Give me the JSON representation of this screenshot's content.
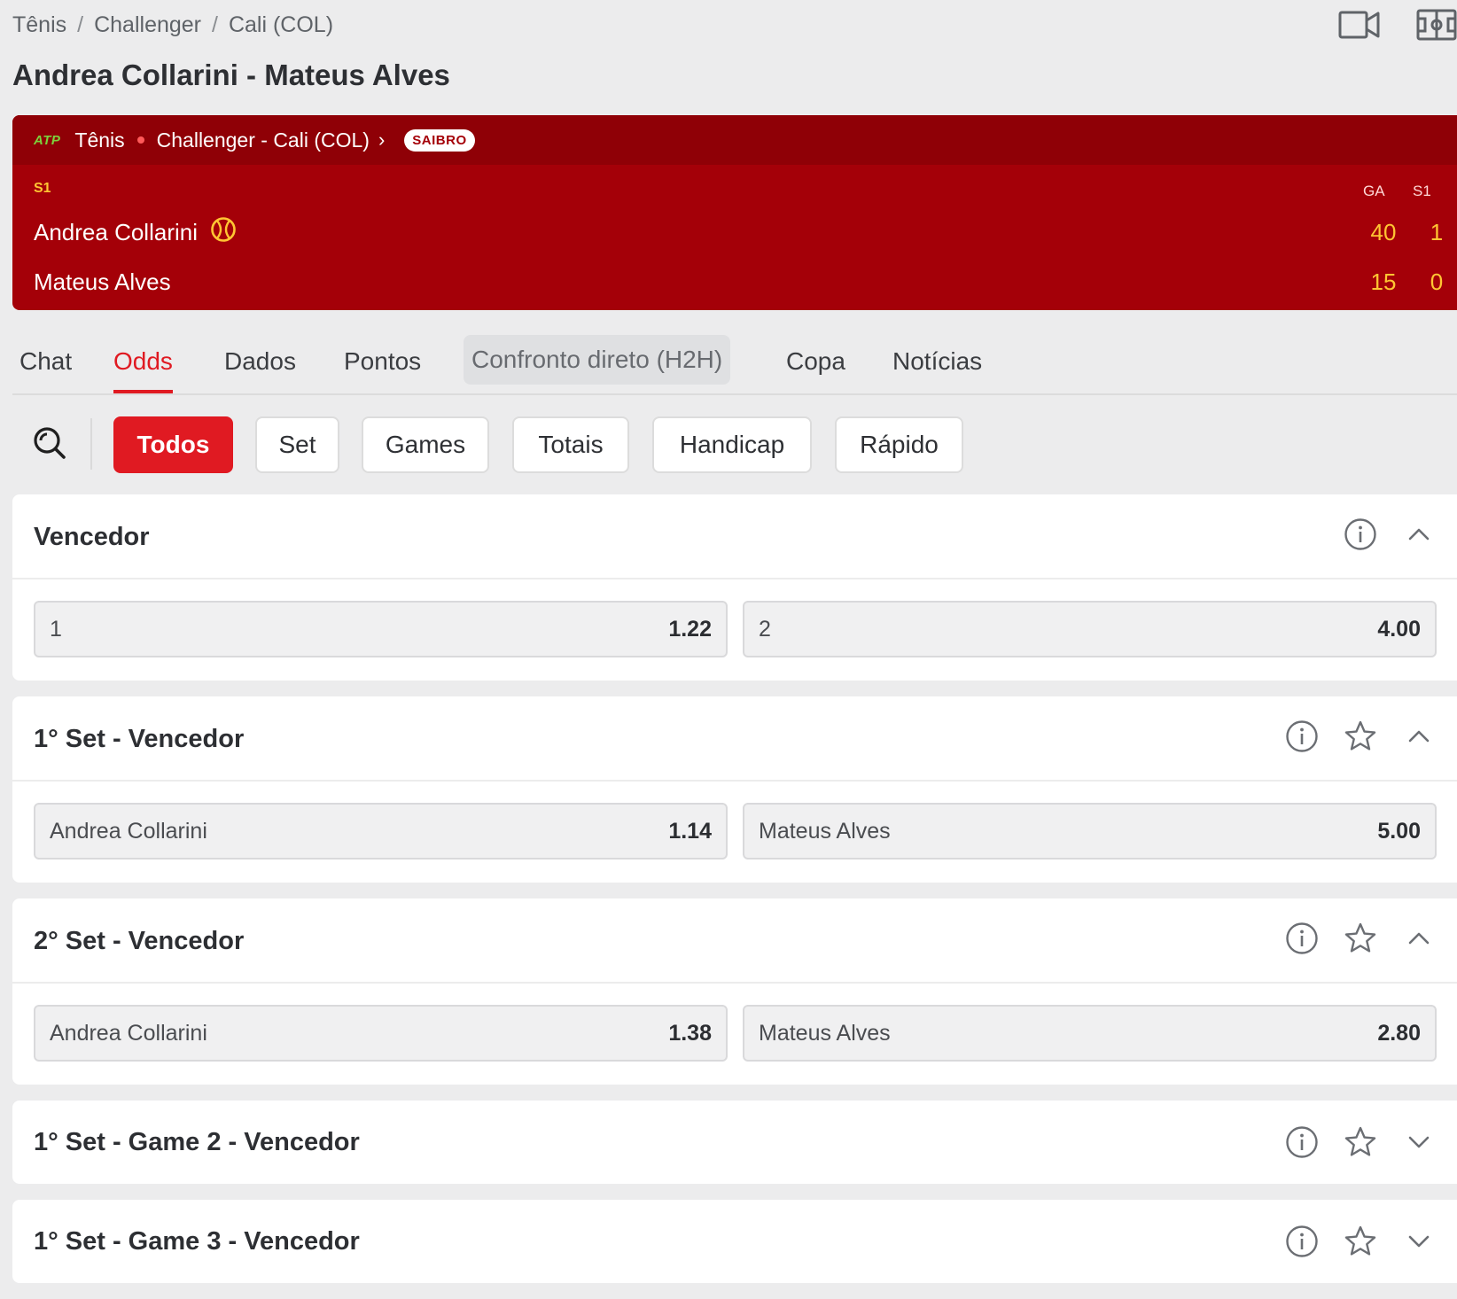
{
  "breadcrumb": {
    "items": [
      "Tênis",
      "Challenger",
      "Cali (COL)"
    ],
    "sep": "/"
  },
  "title": "Andrea Collarini - Mateus Alves",
  "scoreboard": {
    "tour": "ATP",
    "sport": "Tênis",
    "competition": "Challenger - Cali (COL)",
    "chevron": "›",
    "surface": "SAIBRO",
    "set_label": "S1",
    "col_game": "GA",
    "col_set": "S1",
    "players": [
      {
        "name": "Andrea Collarini",
        "serving": true,
        "game": "40",
        "set1": "1"
      },
      {
        "name": "Mateus Alves",
        "serving": false,
        "game": "15",
        "set1": "0"
      }
    ],
    "colors": {
      "header": "#8f0006",
      "body": "#a40008",
      "score": "#ffc533"
    }
  },
  "tabs": [
    {
      "label": "Chat",
      "active": false
    },
    {
      "label": "Odds",
      "active": true
    },
    {
      "label": "Dados",
      "active": false
    },
    {
      "label": "Pontos",
      "active": false
    },
    {
      "label": "Confronto direto (H2H)",
      "active": false,
      "highlighted": true
    },
    {
      "label": "Copa",
      "active": false
    },
    {
      "label": "Notícias",
      "active": false
    }
  ],
  "filters": [
    {
      "label": "Todos",
      "active": true
    },
    {
      "label": "Set",
      "active": false
    },
    {
      "label": "Games",
      "active": false
    },
    {
      "label": "Totais",
      "active": false
    },
    {
      "label": "Handicap",
      "active": false
    },
    {
      "label": "Rápido",
      "active": false
    }
  ],
  "markets": [
    {
      "title": "Vencedor",
      "favorite_icon": false,
      "expanded": true,
      "odds": [
        {
          "label": "1",
          "value": "1.22"
        },
        {
          "label": "2",
          "value": "4.00"
        }
      ]
    },
    {
      "title": "1° Set - Vencedor",
      "favorite_icon": true,
      "expanded": true,
      "odds": [
        {
          "label": "Andrea Collarini",
          "value": "1.14"
        },
        {
          "label": "Mateus Alves",
          "value": "5.00"
        }
      ]
    },
    {
      "title": "2° Set - Vencedor",
      "favorite_icon": true,
      "expanded": true,
      "odds": [
        {
          "label": "Andrea Collarini",
          "value": "1.38"
        },
        {
          "label": "Mateus Alves",
          "value": "2.80"
        }
      ]
    },
    {
      "title": "1° Set - Game 2 - Vencedor",
      "favorite_icon": true,
      "expanded": false,
      "odds": []
    },
    {
      "title": "1° Set - Game 3 - Vencedor",
      "favorite_icon": true,
      "expanded": false,
      "odds": []
    }
  ],
  "icons": {
    "top": [
      "video-camera-icon",
      "field-layout-icon"
    ],
    "market": [
      "info-icon",
      "star-icon",
      "chevron-up-icon",
      "chevron-down-icon"
    ],
    "filter": "search-icon",
    "serve": "tennis-ball-icon"
  },
  "colors": {
    "accent": "#e01a22",
    "background": "#ececed",
    "card": "#ffffff"
  }
}
